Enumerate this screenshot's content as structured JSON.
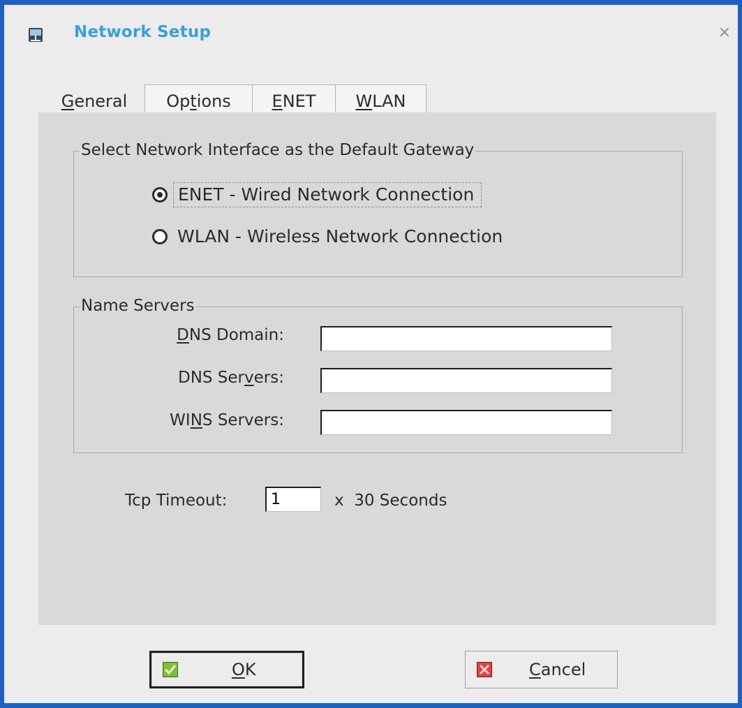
{
  "window": {
    "title": "Network Setup",
    "close_symbol": "×",
    "app_icon": "network-icon",
    "accent_color": "#3aa0d8",
    "frame_color": "#1f5fc4"
  },
  "tabs": [
    {
      "label_u": "G",
      "label_rest": "eneral",
      "active": true
    },
    {
      "label_pre": "Op",
      "label_u": "t",
      "label_rest": "ions",
      "active": false
    },
    {
      "label_u": "E",
      "label_rest": "NET",
      "active": false
    },
    {
      "label_u": "W",
      "label_rest": "LAN",
      "active": false
    }
  ],
  "gateway_group": {
    "title": "Select Network Interface as the Default Gateway",
    "options": [
      {
        "label": "ENET - Wired Network Connection",
        "selected": true
      },
      {
        "label": "WLAN - Wireless Network Connection",
        "selected": false
      }
    ]
  },
  "name_servers": {
    "title": "Name Servers",
    "dns_domain": {
      "label_u": "D",
      "label_rest": "NS Domain:",
      "value": ""
    },
    "dns_servers": {
      "label_pre": "DNS Ser",
      "label_u": "v",
      "label_rest": "ers:",
      "value": ""
    },
    "wins_servers": {
      "label_pre": "WI",
      "label_u": "N",
      "label_rest": "S Servers:",
      "value": ""
    }
  },
  "tcp_timeout": {
    "label": "Tcp Timeout:",
    "value": "1",
    "unit": "x  30 Seconds"
  },
  "buttons": {
    "ok": {
      "label_u": "O",
      "label_rest": "K",
      "icon": "check-icon"
    },
    "cancel": {
      "label_u": "C",
      "label_rest": "ancel",
      "icon": "x-icon"
    }
  }
}
